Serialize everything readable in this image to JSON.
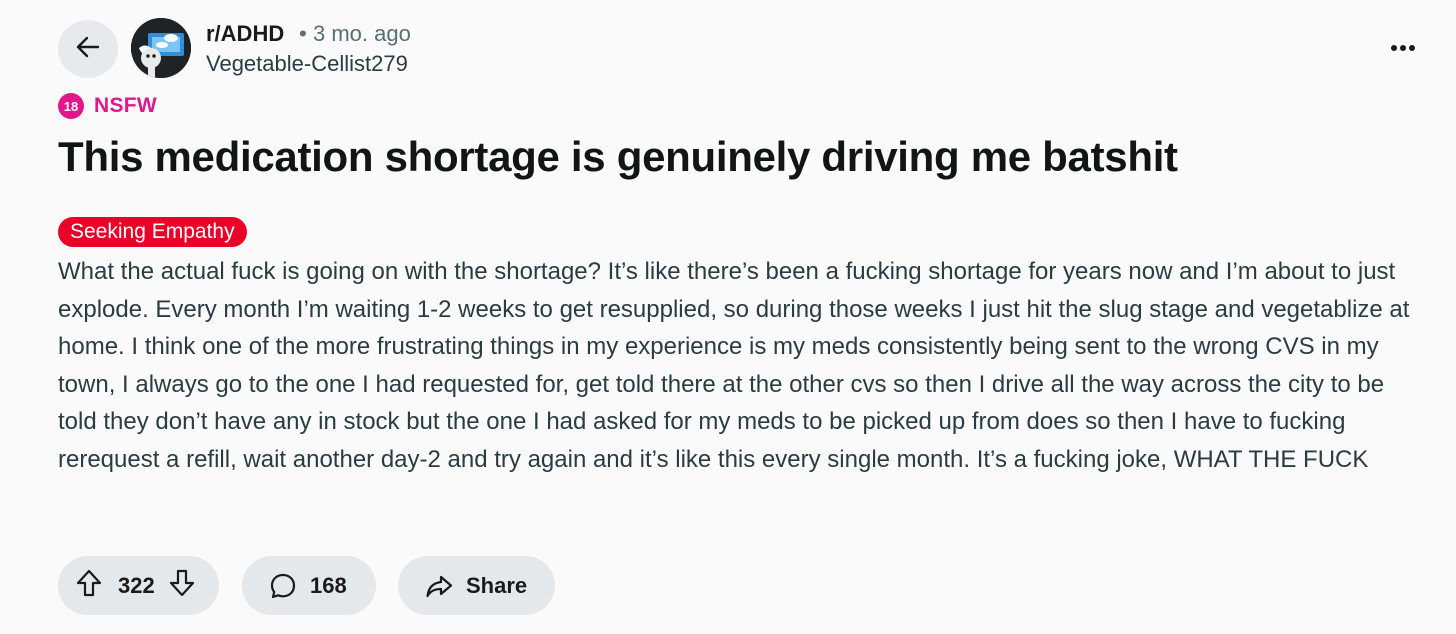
{
  "header": {
    "subreddit": "r/ADHD",
    "separator": "•",
    "time_ago": "3 mo. ago",
    "username": "Vegetable-Cellist279"
  },
  "nsfw": {
    "badge": "18",
    "label": "NSFW",
    "color": "#e0188c"
  },
  "post": {
    "title": "This medication shortage is genuinely driving me batshit",
    "flair": "Seeking Empathy",
    "flair_color": "#ea0027",
    "body": "What the actual fuck is going on with the shortage? It’s like there’s been a fucking shortage for years now and I’m about to just explode. Every month I’m waiting 1-2 weeks to get resupplied, so during those weeks I just hit the slug stage and vegetablize at home. I think one of the more frustrating things in my experience is my meds consistently being sent to the wrong CVS in my town, I always go to the one I had requested for, get told there at the other cvs so then I drive all the way across the city to be told they don’t have any in stock but the one I had asked for my meds to be picked up from does so then I have to fucking rerequest a refill, wait another day-2 and try again and it’s like this every single month. It’s a fucking joke, WHAT THE FUCK"
  },
  "actions": {
    "score": "322",
    "comments": "168",
    "share_label": "Share"
  },
  "icons": {
    "back": "arrow-left-icon",
    "more": "more-horizontal-icon",
    "upvote": "upvote-arrow-icon",
    "downvote": "downvote-arrow-icon",
    "comment": "speech-bubble-icon",
    "share": "share-arrow-icon"
  }
}
